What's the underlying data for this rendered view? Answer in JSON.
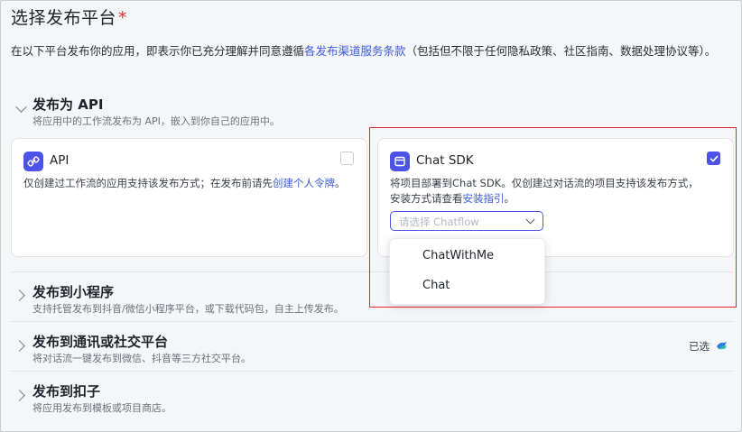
{
  "header": {
    "title": "选择发布平台",
    "required_mark": "*"
  },
  "intro": {
    "prefix": "在以下平台发布你的应用，即表示你已充分理解并同意遵循",
    "link": "各发布渠道服务条款",
    "suffix": "（包括但不限于任何隐私政策、社区指南、数据处理协议等）。"
  },
  "sections": {
    "api": {
      "title": "发布为 API",
      "desc": "将应用中的工作流发布为 API，嵌入到你自己的应用中。"
    },
    "mini": {
      "title": "发布到小程序",
      "desc": "支持托管发布到抖音/微信小程序平台，或下载代码包，自主上传发布。"
    },
    "social": {
      "title": "发布到通讯或社交平台",
      "desc": "将对话流一键发布到微信、抖音等三方社交平台。",
      "selected_label": "已选"
    },
    "coze": {
      "title": "发布到扣子",
      "desc": "将应用发布到模板或项目商店。"
    }
  },
  "cards": {
    "api": {
      "name": "API",
      "desc_prefix": "仅创建过工作流的应用支持该发布方式；在发布前请先",
      "desc_link": "创建个人令牌",
      "desc_suffix": "。",
      "checked": false
    },
    "chat_sdk": {
      "name": "Chat SDK",
      "desc_line1": "将项目部署到Chat SDK。仅创建过对话流的项目支持该发布方式，",
      "desc_line2_prefix": "安装方式请查看",
      "desc_link": "安装指引",
      "desc_line2_suffix": "。",
      "checked": true,
      "select_placeholder": "请选择 Chatflow"
    }
  },
  "dropdown": {
    "options": [
      "ChatWithMe",
      "Chat"
    ]
  },
  "colors": {
    "accent": "#4d53e8",
    "link": "#3d5bd9",
    "highlight": "#e0262a",
    "required": "#e02e2e"
  }
}
